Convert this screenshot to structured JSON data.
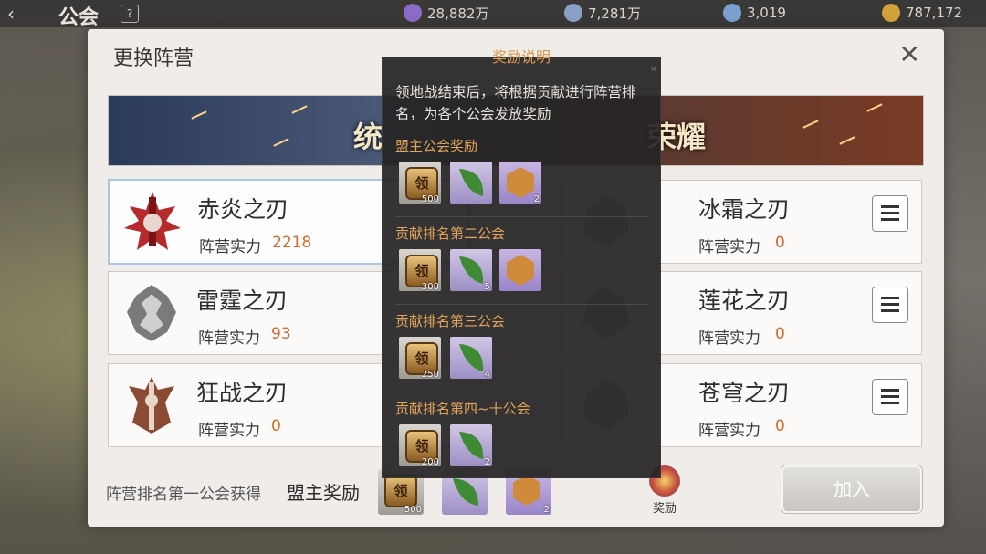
{
  "topbar": {
    "title": "公会",
    "help_label": "?",
    "resources": [
      {
        "name": "resource-1",
        "value": "28,882万",
        "color": "#8a6cc8"
      },
      {
        "name": "resource-2",
        "value": "7,281万",
        "color": "#8aa0c8"
      },
      {
        "name": "resource-3",
        "value": "3,019",
        "color": "#7aa0d0"
      },
      {
        "name": "resource-4",
        "value": "787,172",
        "color": "#d4a23a"
      }
    ]
  },
  "dialog": {
    "title": "更换阵营",
    "close_glyph": "✕",
    "banner_left": "统",
    "banner_right": "荣耀",
    "power_label": "阵营实力",
    "factions": [
      {
        "name": "赤炎之刃",
        "power": "2218",
        "color": "#b52a2a"
      },
      {
        "name": "雷霆之刃",
        "power": "93",
        "color": "#6e6e6e"
      },
      {
        "name": "狂战之刃",
        "power": "0",
        "color": "#8a4a34"
      },
      {
        "name": "冰霜之刃",
        "power": "0",
        "color": "#3a3a3a"
      },
      {
        "name": "莲花之刃",
        "power": "0",
        "color": "#3a3a3a"
      },
      {
        "name": "苍穹之刃",
        "power": "0",
        "color": "#3a3a3a"
      }
    ],
    "footer_label": "阵营排名第一公会获得",
    "footer_title": "盟主奖励",
    "footer_counts": [
      "500",
      "",
      "2"
    ],
    "reward_button_label": "奖励",
    "join_button_label": "加入"
  },
  "tooltip": {
    "header": "奖励说明",
    "close_glyph": "×",
    "description": "领地战结束后，将根据贡献进行阵营排名，为各个公会发放奖励",
    "sections": [
      {
        "title": "盟主公会奖励",
        "items": [
          {
            "type": "token",
            "count": "500"
          },
          {
            "type": "leaf",
            "count": ""
          },
          {
            "type": "badge",
            "count": "2"
          }
        ]
      },
      {
        "title": "贡献排名第二公会",
        "items": [
          {
            "type": "token",
            "count": "300"
          },
          {
            "type": "leaf",
            "count": "5"
          },
          {
            "type": "badge",
            "count": ""
          }
        ]
      },
      {
        "title": "贡献排名第三公会",
        "items": [
          {
            "type": "token",
            "count": "250"
          },
          {
            "type": "leaf",
            "count": "4"
          }
        ]
      },
      {
        "title": "贡献排名第四~十公会",
        "items": [
          {
            "type": "token",
            "count": "200"
          },
          {
            "type": "leaf",
            "count": "2"
          }
        ]
      }
    ],
    "token_glyph": "领"
  }
}
